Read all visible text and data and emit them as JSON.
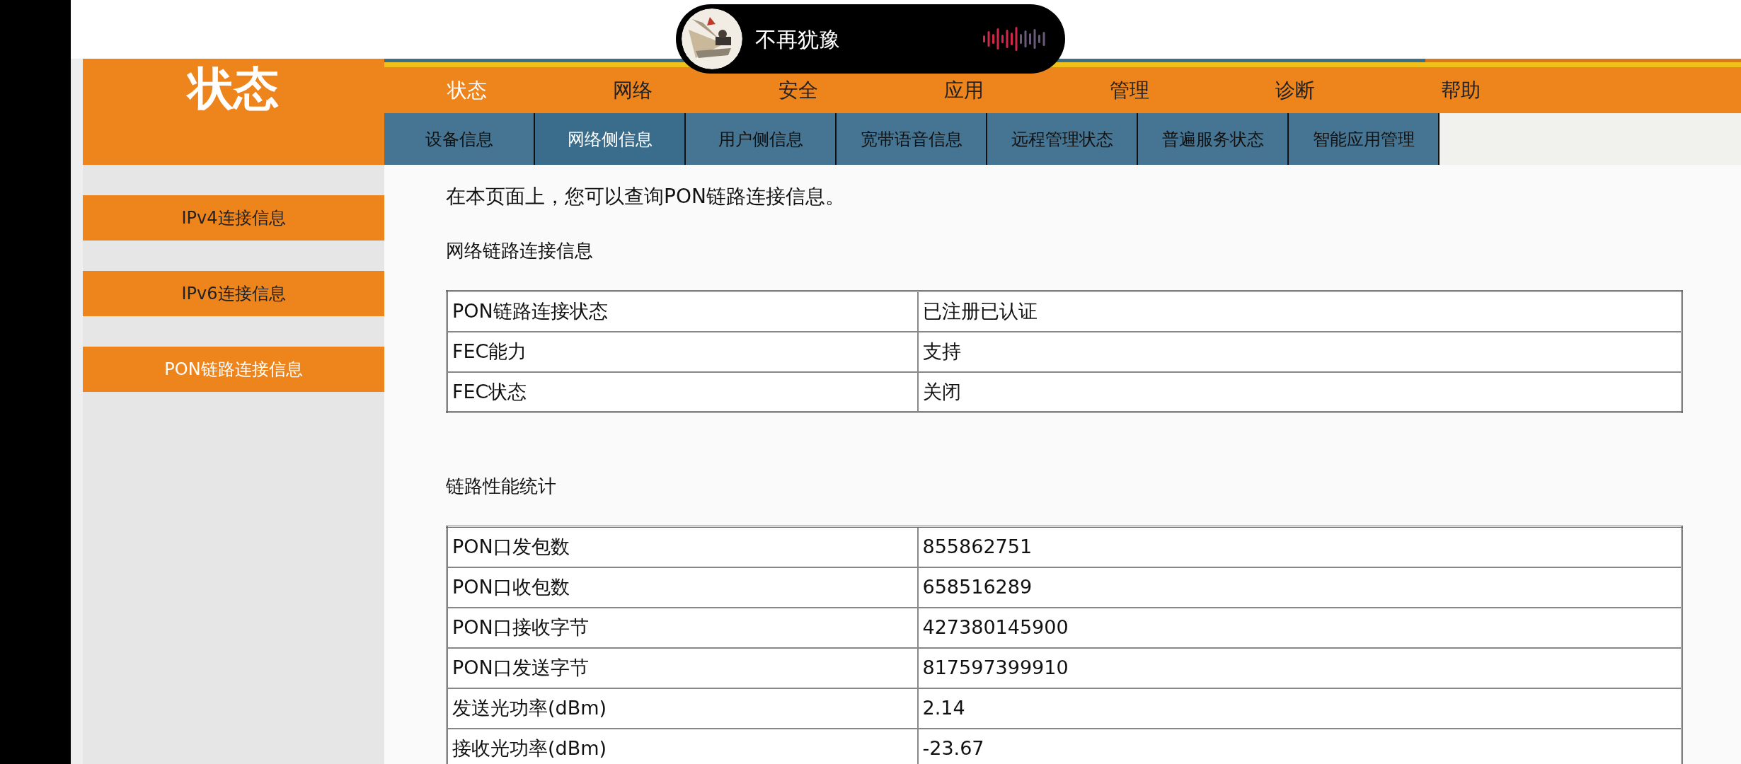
{
  "header": {
    "title": "状态"
  },
  "nav": [
    {
      "label": "状态",
      "selected": true
    },
    {
      "label": "网络",
      "selected": false
    },
    {
      "label": "安全",
      "selected": false
    },
    {
      "label": "应用",
      "selected": false
    },
    {
      "label": "管理",
      "selected": false
    },
    {
      "label": "诊断",
      "selected": false
    },
    {
      "label": "帮助",
      "selected": false
    }
  ],
  "subnav": [
    {
      "label": "设备信息",
      "selected": false
    },
    {
      "label": "网络侧信息",
      "selected": true
    },
    {
      "label": "用户侧信息",
      "selected": false
    },
    {
      "label": "宽带语音信息",
      "selected": false
    },
    {
      "label": "远程管理状态",
      "selected": false
    },
    {
      "label": "普遍服务状态",
      "selected": false
    },
    {
      "label": "智能应用管理",
      "selected": false
    }
  ],
  "sidebar": {
    "items": [
      {
        "label": "IPv4连接信息",
        "selected": false
      },
      {
        "label": "IPv6连接信息",
        "selected": false
      },
      {
        "label": "PON链路连接信息",
        "selected": true
      }
    ]
  },
  "intro": "在本页面上，您可以查询PON链路连接信息。",
  "sections": [
    {
      "title": "网络链路连接信息",
      "rows": [
        [
          "PON链路连接状态",
          "已注册已认证"
        ],
        [
          "FEC能力",
          "支持"
        ],
        [
          "FEC状态",
          "关闭"
        ]
      ]
    },
    {
      "title": "链路性能统计",
      "rows": [
        [
          "PON口发包数",
          "855862751"
        ],
        [
          "PON口收包数",
          "658516289"
        ],
        [
          "PON口接收字节",
          "427380145900"
        ],
        [
          "PON口发送字节",
          "817597399910"
        ],
        [
          "发送光功率(dBm)",
          "2.14"
        ],
        [
          "接收光功率(dBm)",
          "-23.67"
        ]
      ]
    }
  ],
  "now_playing": {
    "title": "不再犹豫"
  }
}
